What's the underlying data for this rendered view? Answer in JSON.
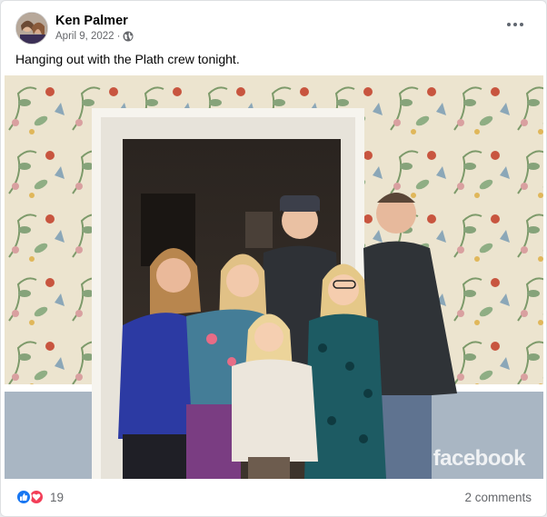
{
  "post": {
    "author": "Ken Palmer",
    "date": "April 9, 2022",
    "date_separator": "·",
    "text": "Hanging out with the Plath crew tonight.",
    "watermark": "facebook",
    "reaction_count": "19",
    "comments": "2 comments"
  },
  "icons": {
    "privacy": "globe-icon",
    "menu": "more-options-icon",
    "like": "like-reaction-icon",
    "love": "love-reaction-icon"
  },
  "colors": {
    "like": "#1877f2",
    "love": "#f33e58",
    "secondary_text": "#65676b"
  }
}
